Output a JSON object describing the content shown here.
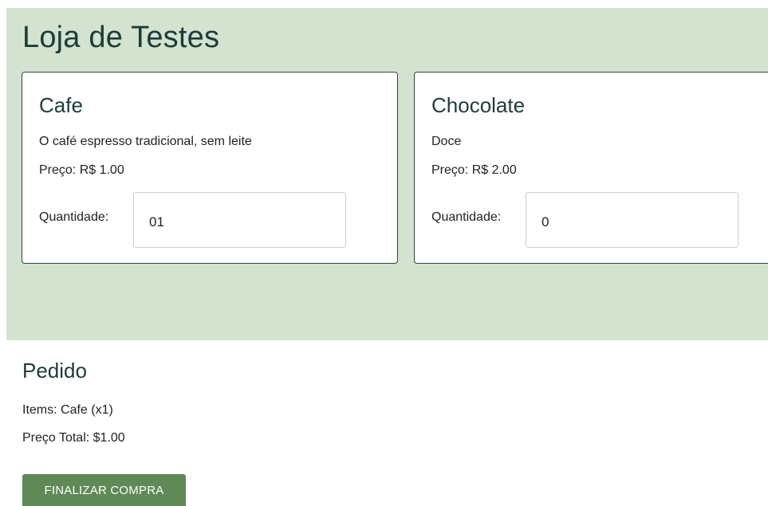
{
  "store": {
    "title": "Loja de Testes"
  },
  "products": [
    {
      "name": "Cafe",
      "description": "O café espresso tradicional, sem leite",
      "price_text": "Preço: R$ 1.00",
      "quantity_label": "Quantidade:",
      "quantity_value": "01"
    },
    {
      "name": "Chocolate",
      "description": "Doce",
      "price_text": "Preço: R$ 2.00",
      "quantity_label": "Quantidade:",
      "quantity_value": "0"
    }
  ],
  "order": {
    "title": "Pedido",
    "items_text": "Items: Cafe (x1)",
    "total_text": "Preço Total: $1.00",
    "checkout_label": "FINALIZAR COMPRA"
  },
  "colors": {
    "panel_background": "#d3e3cf",
    "button_background": "#5f8a57",
    "heading_text": "#1e3b3a"
  }
}
